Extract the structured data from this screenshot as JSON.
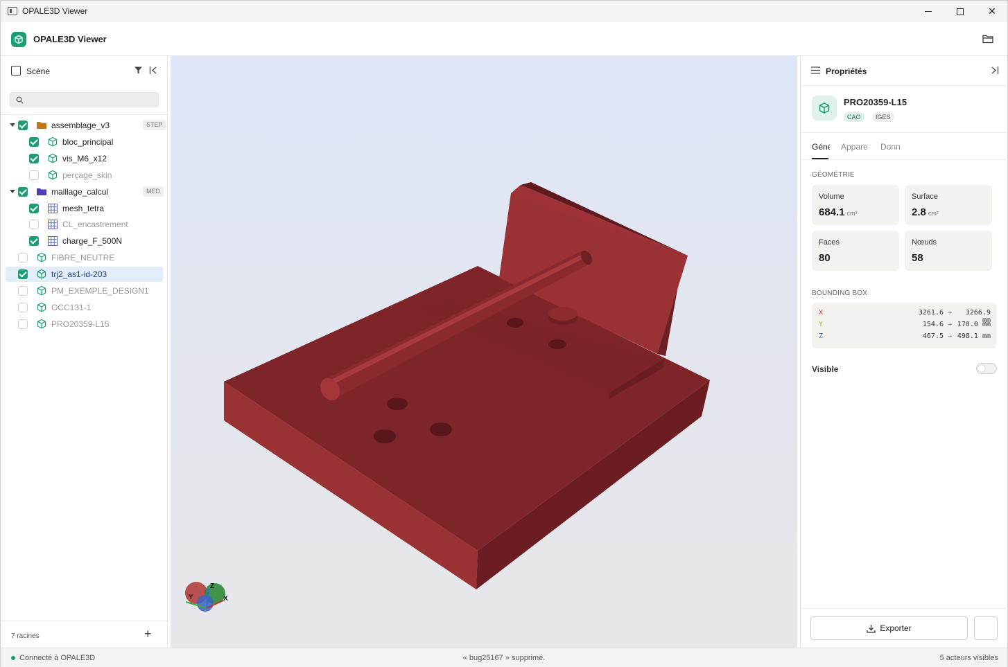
{
  "window": {
    "title": "OPALE3D Viewer"
  },
  "app": {
    "name": "OPALE3D Viewer"
  },
  "scene_panel": {
    "title": "Scène",
    "search": {
      "value": "",
      "placeholder": ""
    },
    "tree": [
      {
        "label": "assemblage_v3",
        "kind": "folder",
        "checked": true,
        "expanded": true,
        "tag": "STEP",
        "depth": 0
      },
      {
        "label": "bloc_principal",
        "kind": "cube",
        "checked": true,
        "depth": 1
      },
      {
        "label": "vis_M6_x12",
        "kind": "cube",
        "checked": true,
        "depth": 1
      },
      {
        "label": "perçage_skin",
        "kind": "cube",
        "checked": false,
        "depth": 1
      },
      {
        "label": "maillage_calcul",
        "kind": "folder",
        "checked": true,
        "expanded": true,
        "tag": "MED",
        "depth": 0
      },
      {
        "label": "mesh_tetra",
        "kind": "grid",
        "checked": true,
        "depth": 1
      },
      {
        "label": "CL_encastrement",
        "kind": "grid",
        "checked": false,
        "depth": 1
      },
      {
        "label": "charge_F_500N",
        "kind": "grid",
        "checked": true,
        "depth": 1
      },
      {
        "label": "FIBRE_NEUTRE",
        "kind": "cube",
        "checked": false,
        "depth": 0
      },
      {
        "label": "trj2_as1-id-203",
        "kind": "cube",
        "checked": true,
        "depth": 0,
        "selected": true
      },
      {
        "label": "PM_EXEMPLE_DESIGN1",
        "kind": "cube",
        "checked": false,
        "depth": 0
      },
      {
        "label": "OCC131-1",
        "kind": "cube",
        "checked": false,
        "depth": 0
      },
      {
        "label": "PRO20359-L15",
        "kind": "cube",
        "checked": false,
        "depth": 0
      }
    ],
    "footer": {
      "roots": "7 racines",
      "add": "+"
    }
  },
  "viewport": {
    "model_color": "#7d2529",
    "axes": {
      "x": "X",
      "y": "Y",
      "z": "Z"
    }
  },
  "properties": {
    "title": "Propriétés",
    "object": {
      "name": "PRO20359-L15",
      "chips": [
        "CAO",
        "IGES"
      ]
    },
    "tabs": [
      "Géné",
      "Appare",
      "Donn"
    ],
    "geometry_title": "GÉOMÉTRIE",
    "cards": {
      "volume": {
        "label": "Volume",
        "value": "684.1",
        "unit": "cm³"
      },
      "surface": {
        "label": "Surface",
        "value": "2.8",
        "unit": "cm²"
      },
      "faces": {
        "label": "Faces",
        "value": "80"
      },
      "nodes": {
        "label": "Nœuds",
        "value": "58"
      }
    },
    "bbox_title": "BOUNDING BOX",
    "bbox": [
      {
        "axis": "X",
        "min": "3261.6",
        "max": "3266.9 mm",
        "color": "#d9463b"
      },
      {
        "axis": "Y",
        "min": "154.6",
        "max": "170.0 mm",
        "color": "#9bbf3a"
      },
      {
        "axis": "Z",
        "min": "467.5",
        "max": "498.1 mm",
        "color": "#3b7bd9"
      }
    ],
    "arrow": "→",
    "visible_label": "Visible",
    "visible": false,
    "export_label": "Exporter"
  },
  "status": {
    "connection": "Connecté à OPALE3D",
    "message": "« bug25167 » supprimé.",
    "actors": "5  acteurs visibles"
  },
  "colors": {
    "accent": "#1a9e73",
    "selection": "#e3edf9"
  }
}
